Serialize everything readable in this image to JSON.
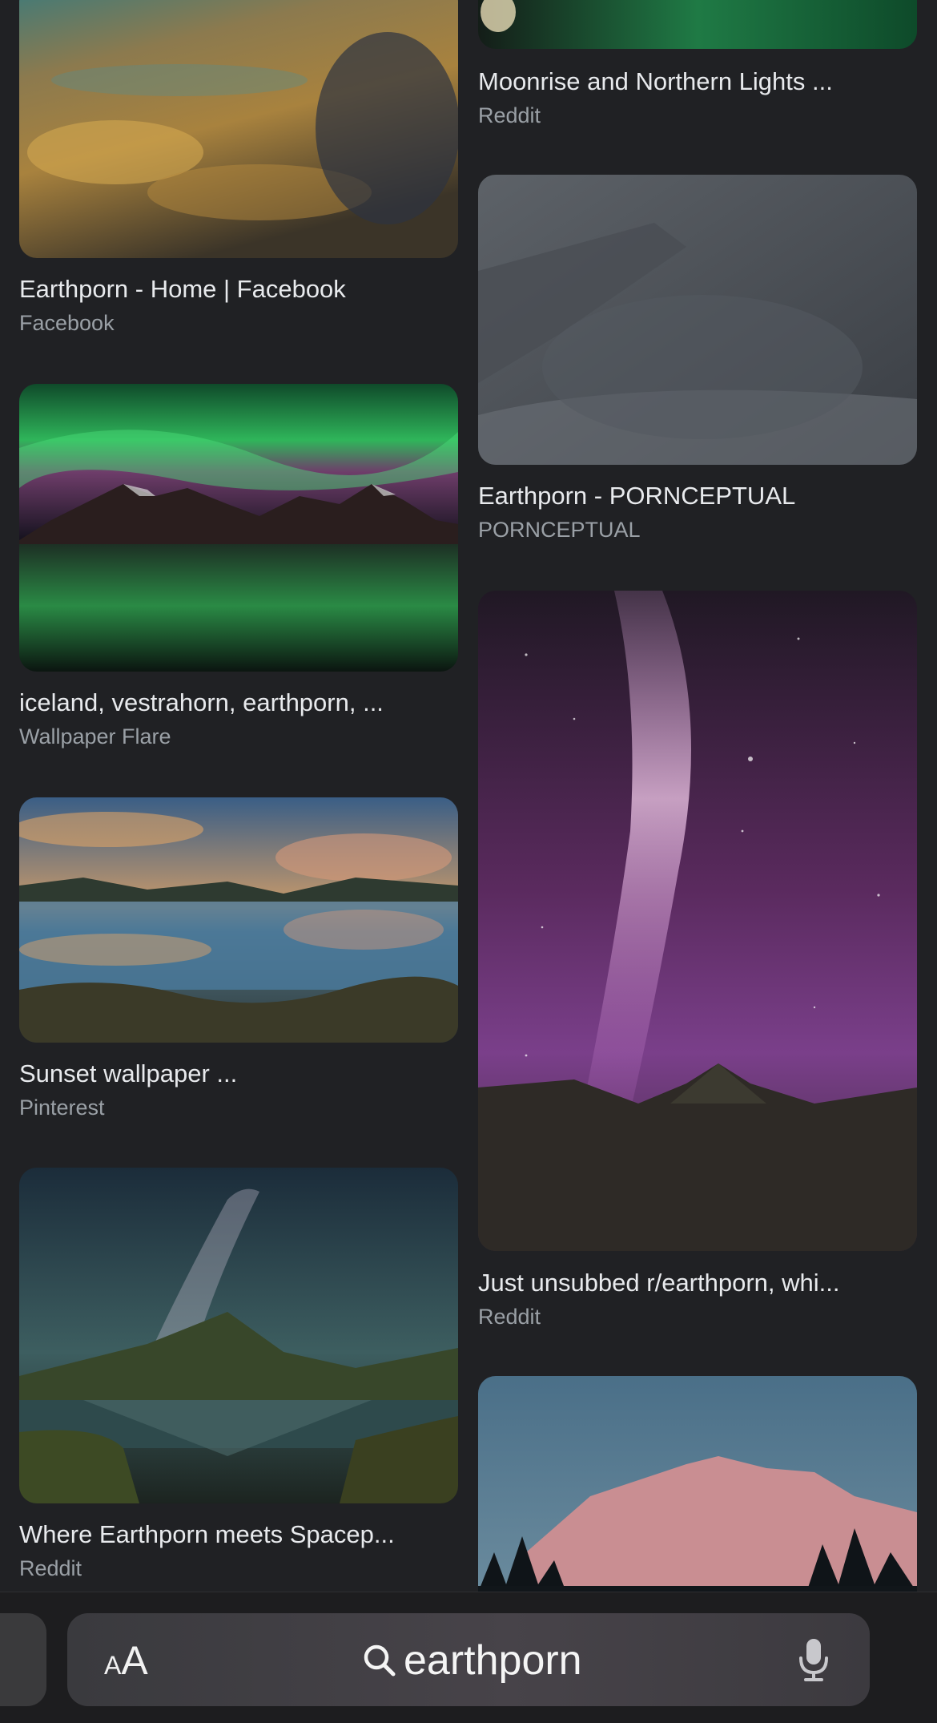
{
  "results": {
    "left": [
      {
        "title": "Earthporn - Home | Facebook",
        "source": "Facebook"
      },
      {
        "title": "iceland, vestrahorn, earthporn, ...",
        "source": "Wallpaper Flare"
      },
      {
        "title": "Sunset wallpaper ...",
        "source": "Pinterest"
      },
      {
        "title": "Where Earthporn meets Spacep...",
        "source": "Reddit"
      }
    ],
    "right": [
      {
        "title": "Moonrise and Northern Lights ...",
        "source": "Reddit"
      },
      {
        "title": "Earthporn - PORNCEPTUAL",
        "source": "PORNCEPTUAL"
      },
      {
        "title": "Just unsubbed r/earthporn, whi...",
        "source": "Reddit"
      },
      {
        "title": "",
        "source": ""
      }
    ]
  },
  "toolbar": {
    "reader_label_small": "A",
    "reader_label_big": "A",
    "search_query": "earthporn",
    "search_icon": "search-icon",
    "mic_icon": "microphone-icon"
  }
}
